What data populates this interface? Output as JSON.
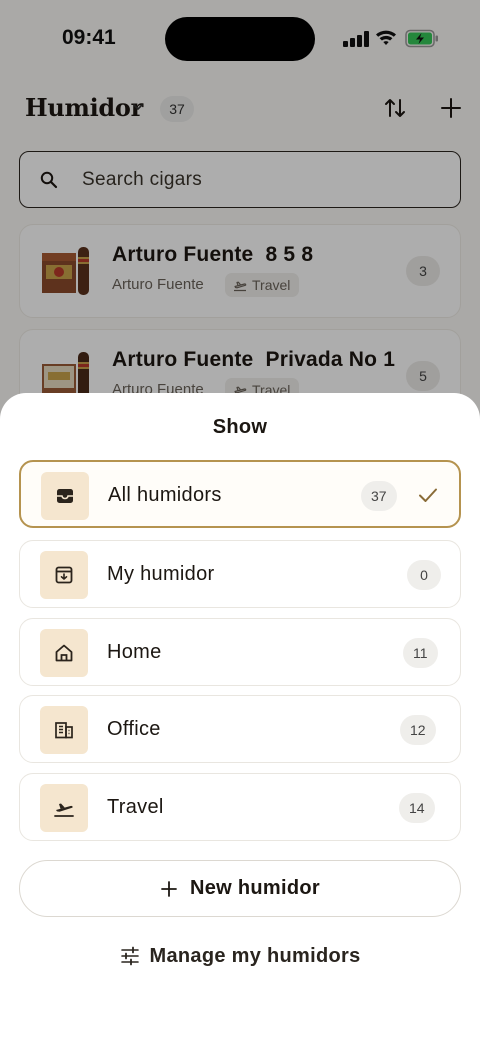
{
  "status_bar": {
    "time": "09:41"
  },
  "header": {
    "title": "Humidor",
    "count": "37"
  },
  "search": {
    "placeholder": "Search cigars"
  },
  "cigars": [
    {
      "name": "Arturo Fuente  8 5 8",
      "brand": "Arturo Fuente",
      "tag": "Travel",
      "count": "3"
    },
    {
      "name": "Arturo Fuente  Privada No 1",
      "brand": "Arturo Fuente",
      "tag": "Travel",
      "count": "5"
    }
  ],
  "sheet": {
    "title": "Show",
    "options": [
      {
        "label": "All humidors",
        "count": "37",
        "icon": "inbox-tray-icon",
        "selected": true
      },
      {
        "label": "My humidor",
        "count": "0",
        "icon": "archive-box-icon",
        "selected": false
      },
      {
        "label": "Home",
        "count": "11",
        "icon": "home-icon",
        "selected": false
      },
      {
        "label": "Office",
        "count": "12",
        "icon": "office-building-icon",
        "selected": false
      },
      {
        "label": "Travel",
        "count": "14",
        "icon": "airplane-departure-icon",
        "selected": false
      }
    ],
    "new_label": "New humidor",
    "manage_label": "Manage my humidors"
  },
  "colors": {
    "accent": "#b5934f",
    "icon_bg": "#f5e6cf",
    "text": "#1c1712"
  }
}
